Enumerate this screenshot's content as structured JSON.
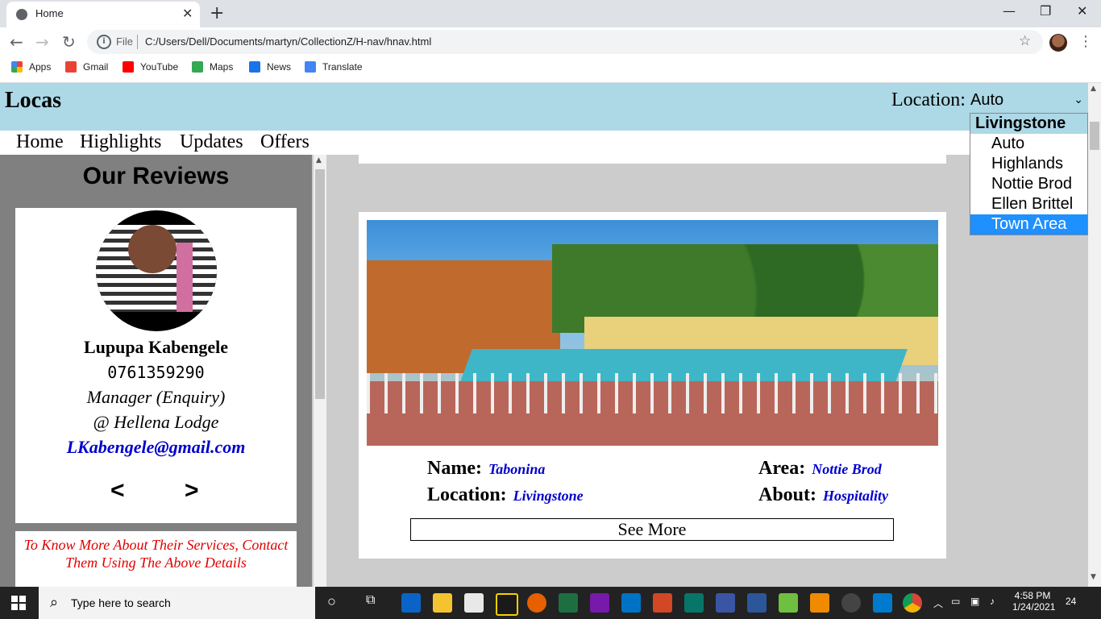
{
  "browser": {
    "tab_title": "Home",
    "url_scheme": "File",
    "url": "C:/Users/Dell/Documents/martyn/CollectionZ/H-nav/hnav.html",
    "bookmarks": [
      "Apps",
      "Gmail",
      "YouTube",
      "Maps",
      "News",
      "Translate"
    ],
    "bookmark_colors": [
      "#4285f4",
      "#ea4335",
      "#ff0000",
      "#34a853",
      "#1a73e8",
      "#4285f4"
    ]
  },
  "site": {
    "logo": "Locas",
    "location_label": "Location:",
    "location_value": "Auto",
    "nav": [
      "Home",
      "Highlights",
      "Updates",
      "Offers"
    ]
  },
  "dropdown": {
    "group": "Livingstone",
    "options": [
      "Auto",
      "Highlands",
      "Nottie Brod",
      "Ellen Brittel",
      "Town Area"
    ],
    "highlighted": "Town Area"
  },
  "reviews": {
    "heading": "Our Reviews",
    "name": "Lupupa Kabengele",
    "phone": "0761359290",
    "role": "Manager (Enquiry)",
    "place": "@ Hellena Lodge",
    "email": "LKabengele@gmail.com",
    "prev": "<",
    "next": ">",
    "note": "To Know More About Their Services, Contact Them Using The Above Details"
  },
  "listing": {
    "name_label": "Name:",
    "name": "Tabonina",
    "location_label": "Location:",
    "location": "Livingstone",
    "area_label": "Area:",
    "area": "Nottie Brod",
    "about_label": "About:",
    "about": "Hospitality",
    "button": "See More"
  },
  "taskbar": {
    "search_placeholder": "Type here to search",
    "time": "4:58 PM",
    "date": "1/24/2021",
    "notifications": "24"
  }
}
